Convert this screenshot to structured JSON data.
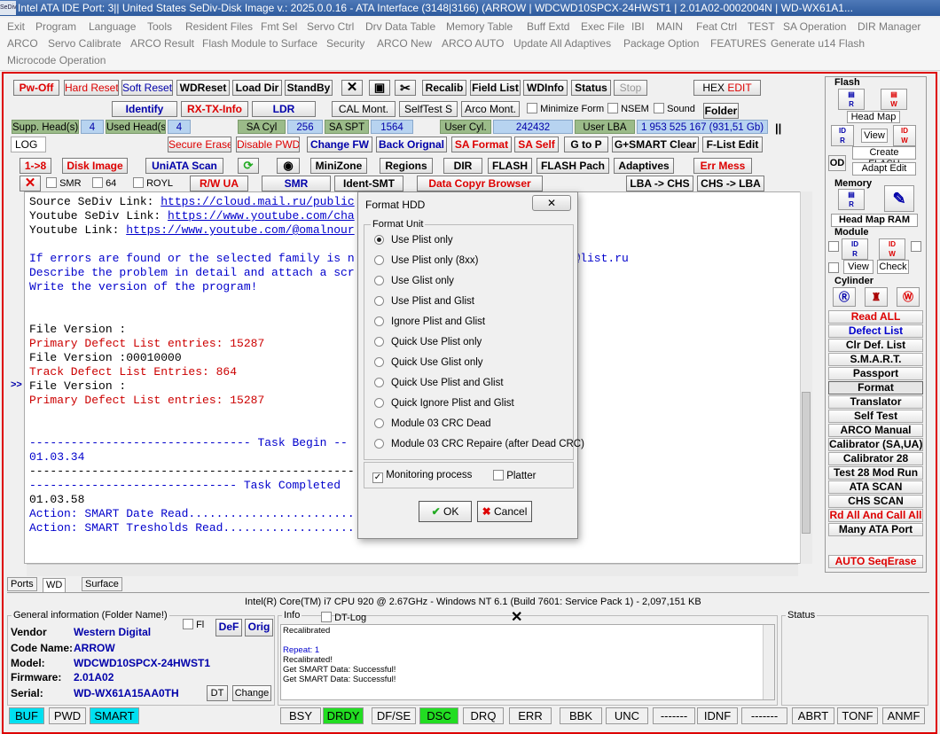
{
  "title": "Intel ATA IDE  Port: 3|| United States  SeDiv-Disk Image v.: 2025.0.0.16 - ATA Interface (3148|3166)  (ARROW | WDCWD10SPCX-24HWST1 | 2.01A02-0002004N | WD-WX61A1...",
  "title_icon": "SeDiv",
  "menu_row1": [
    "Exit",
    "Program",
    "Language",
    "Tools",
    "Resident Files",
    "Fmt Sel",
    "Servo Ctrl",
    "Drv Data Table",
    "Memory Table",
    "Buff Extd",
    "Exec File",
    "IBI",
    "MAIN",
    "Feat Ctrl",
    "TEST",
    "SA Operation",
    "DIR Manager"
  ],
  "menu_row2": [
    "ARCO",
    "Servo Calibrate",
    "ARCO Result",
    "Flash Module to Surface",
    "Security",
    "ARCO New",
    "ARCO AUTO",
    "Update All Adaptives",
    "Package Option",
    "FEATURES",
    "Generate u14 Flash"
  ],
  "menu_row3": [
    "Microcode Operation"
  ],
  "toolbar": {
    "pwoff": "Pw-Off",
    "hardreset": "Hard Reset",
    "softreset": "Soft Reset",
    "wdreset": "WDReset",
    "loaddir": "Load Dir",
    "standby": "StandBy",
    "recalib": "Recalib",
    "fieldlist": "Field List",
    "wdinfo": "WDInfo",
    "status": "Status",
    "stop": "Stop",
    "hexedit_a": "HEX",
    "hexedit_b": "EDIT",
    "identify": "Identify",
    "rxtx": "RX-TX-Info",
    "ldr": "LDR",
    "calmont": "CAL Mont.",
    "selftest": "SelfTest S",
    "arcomont": "Arco Mont.",
    "minform": "Minimize Form",
    "nsem": "NSEM",
    "sound": "Sound",
    "folder": "Folder",
    "supp": "Supp. Head(s)",
    "supp_v": "4",
    "used": "Used Head(s)",
    "used_v": "4",
    "sacyl": "SA Cyl",
    "sacyl_v": "256",
    "saspt": "SA SPT",
    "saspt_v": "1564",
    "ucyl": "User Cyl.",
    "ucyl_v": "242432",
    "ulba": "User LBA",
    "ulba_v": "1 953 525 167  (931,51 Gb)",
    "log": "LOG",
    "secerase": "Secure Erase",
    "dispwd": "Disable PWD",
    "changefw": "Change FW",
    "backorig": "Back Orignal",
    "saformat": "SA Format",
    "saself": "SA Self",
    "gtop": "G to P",
    "gsmart": "G+SMART Clear",
    "flist": "F-List Edit",
    "r18": "1->8",
    "diskimage": "Disk Image",
    "uniata": "UniATA Scan",
    "minizone": "MiniZone",
    "regions": "Regions",
    "dir": "DIR",
    "flash": "FLASH",
    "flashpach": "FLASH Pach",
    "adaptives": "Adaptives",
    "errmess": "Err Mess",
    "smr": "SMR",
    "b64": "64",
    "royl": "ROYL",
    "rwua": "R/W UA",
    "smr2": "SMR",
    "identsmt": "Ident-SMT",
    "datacopy": "Data Copyr Browser",
    "lbachs": "LBA -> CHS",
    "chslba": "CHS -> LBA"
  },
  "log_lines": [
    {
      "t": "Source SeDiv Link: ",
      "l": "https://cloud.mail.ru/public",
      "c": "#000"
    },
    {
      "t": "Youtube SeDiv Link: ",
      "l": "https://www.youtube.com/cha",
      "c": "#000"
    },
    {
      "t": "Youtube Link: ",
      "l": "https://www.youtube.com/@omalnour",
      "c": "#000"
    },
    {
      "t": "",
      "l": "",
      "c": "#000"
    },
    {
      "t": "If errors are found or the selected family is n",
      "l": "",
      "c": "#00c",
      "tail": "Div@list.ru"
    },
    {
      "t": "Describe the problem in detail and attach a scr",
      "l": "",
      "c": "#00c"
    },
    {
      "t": "Write the version of the program!",
      "l": "",
      "c": "#00c"
    },
    {
      "t": "",
      "l": "",
      "c": "#000"
    },
    {
      "t": "",
      "l": "",
      "c": "#000"
    },
    {
      "t": "File Version :",
      "l": "",
      "c": "#000"
    },
    {
      "t": "Primary Defect List entries: 15287",
      "l": "",
      "c": "#c00"
    },
    {
      "t": "File Version :00010000",
      "l": "",
      "c": "#000"
    },
    {
      "t": "Track Defect List Entries: 864",
      "l": "",
      "c": "#c00"
    },
    {
      "t": "File Version :",
      "l": "",
      "c": "#000"
    },
    {
      "t": "Primary Defect List entries: 15287",
      "l": "",
      "c": "#c00"
    },
    {
      "t": "",
      "l": "",
      "c": "#000"
    },
    {
      "t": "",
      "l": "",
      "c": "#000"
    },
    {
      "t": "-------------------------------- Task Begin --",
      "l": "",
      "c": "#00c"
    },
    {
      "t": "01.03.34",
      "l": "",
      "c": "#00c"
    },
    {
      "t": "-----------------------------------------------",
      "l": "",
      "c": "#000"
    },
    {
      "t": "------------------------------ Task Completed",
      "l": "",
      "c": "#00c"
    },
    {
      "t": "01.03.58",
      "l": "",
      "c": "#000"
    },
    {
      "t": "Action: SMART Date Read........................",
      "l": "",
      "c": "#00c"
    },
    {
      "t": "Action: SMART Tresholds Read...................",
      "l": "",
      "c": "#00c"
    }
  ],
  "right_panel": {
    "flash": "Flash",
    "headmap": "Head Map",
    "view": "View",
    "createflash": "Create FLASH",
    "adaptedit": "Adapt Edit",
    "od": "OD",
    "memory": "Memory",
    "headmapram": "Head Map RAM",
    "module": "Module",
    "mview": "View",
    "mcheck": "Check",
    "cylinder": "Cylinder",
    "buttons": [
      {
        "label": "Read ALL",
        "c": "#d00"
      },
      {
        "label": "Defect List",
        "c": "#00c"
      },
      {
        "label": "Clr Def. List",
        "c": "#000"
      },
      {
        "label": "S.M.A.R.T.",
        "c": "#000"
      },
      {
        "label": "Passport",
        "c": "#000"
      },
      {
        "label": "Format",
        "c": "#000"
      },
      {
        "label": "Translator",
        "c": "#000"
      },
      {
        "label": "Self Test",
        "c": "#000"
      },
      {
        "label": "ARCO Manual",
        "c": "#000"
      },
      {
        "label": "Calibrator (SA,UA)",
        "c": "#000"
      },
      {
        "label": "Calibrator 28",
        "c": "#000"
      },
      {
        "label": "Test 28 Mod Run",
        "c": "#000"
      },
      {
        "label": "ATA SCAN",
        "c": "#000"
      },
      {
        "label": "CHS SCAN",
        "c": "#000"
      },
      {
        "label": "Rd All And Call All",
        "c": "#d00"
      },
      {
        "label": "Many ATA Port",
        "c": "#000"
      }
    ],
    "autoseq": "AUTO SeqErase"
  },
  "dialog": {
    "title": "Format HDD",
    "group": "Format Unit",
    "options": [
      "Use Plist only",
      "Use Plist only (8xx)",
      "Use Glist only",
      "Use Plist and Glist",
      "Ignore Plist and Glist",
      "Quick Use Plist only",
      "Quick Use Glist only",
      "Quick Use Plist and Glist",
      "Quick Ignore Plist and Glist",
      "Module 03 CRC Dead",
      "Module 03 CRC Repaire (after Dead CRC)"
    ],
    "monitoring": "Monitoring process",
    "platter": "Platter",
    "ok": "OK",
    "cancel": "Cancel"
  },
  "tabs": [
    "Ports",
    "WD",
    "Surface"
  ],
  "cpu": "Intel(R) Core(TM) i7 CPU 920  @ 2.67GHz - Windows NT 6.1 (Build 7601: Service Pack 1) -  2,097,151 KB",
  "general": {
    "header": "General information (Folder Name!)",
    "fl": "Fl",
    "def": "DeF",
    "orig": "Orig",
    "vendor_l": "Vendor",
    "vendor": "Western Digital",
    "code_l": "Code Name:",
    "code": "ARROW",
    "model_l": "Model:",
    "model": "WDCWD10SPCX-24HWST1",
    "fw_l": "Firmware:",
    "fw": "2.01A02",
    "serial_l": "Serial:",
    "serial": "WD-WX61A15AA0TH",
    "dt": "DT",
    "change": "Change"
  },
  "info": {
    "tab1": "Info",
    "tab2": "DT-Log",
    "lines": [
      "Recalibrated",
      "",
      "Repeat: 1",
      "Recalibrated!",
      "Get SMART Data: Successful!",
      "Get SMART Data: Successful!"
    ]
  },
  "status_label": "Status",
  "statusbar": [
    {
      "label": "BUF",
      "bg": "#00e0f0"
    },
    {
      "label": "PWD",
      "bg": "#f0f0f0"
    },
    {
      "label": "SMART",
      "bg": "#00e0f0"
    },
    {
      "label": "BSY",
      "bg": "#f0f0f0"
    },
    {
      "label": "DRDY",
      "bg": "#22dd22"
    },
    {
      "label": "DF/SE",
      "bg": "#f0f0f0"
    },
    {
      "label": "DSC",
      "bg": "#22dd22"
    },
    {
      "label": "DRQ",
      "bg": "#f0f0f0"
    },
    {
      "label": "ERR",
      "bg": "#f0f0f0"
    },
    {
      "label": "BBK",
      "bg": "#f0f0f0"
    },
    {
      "label": "UNC",
      "bg": "#f0f0f0"
    },
    {
      "label": "-------",
      "bg": "#f0f0f0"
    },
    {
      "label": "IDNF",
      "bg": "#f0f0f0"
    },
    {
      "label": "-------",
      "bg": "#f0f0f0"
    },
    {
      "label": "ABRT",
      "bg": "#f0f0f0"
    },
    {
      "label": "TONF",
      "bg": "#f0f0f0"
    },
    {
      "label": "ANMF",
      "bg": "#f0f0f0"
    }
  ]
}
